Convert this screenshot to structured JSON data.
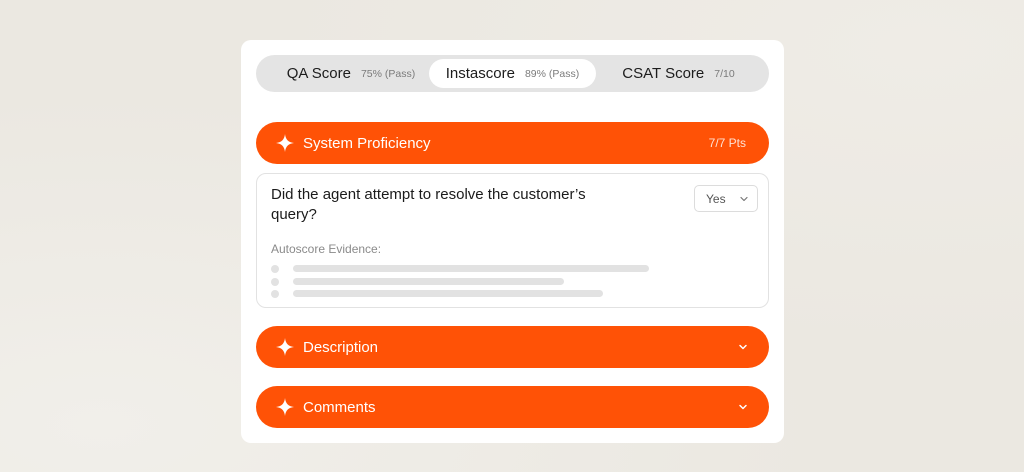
{
  "tabs": [
    {
      "label": "QA Score",
      "meta": "75% (Pass)",
      "active": false
    },
    {
      "label": "Instascore",
      "meta": "89% (Pass)",
      "active": true
    },
    {
      "label": "CSAT Score",
      "meta": "7/10",
      "active": false
    }
  ],
  "sections": {
    "system_proficiency": {
      "title": "System Proficiency",
      "points": "7/7 Pts",
      "icon": "sparkle-icon"
    },
    "description": {
      "title": "Description",
      "icon": "sparkle-icon"
    },
    "comments": {
      "title": "Comments",
      "icon": "sparkle-icon"
    }
  },
  "question": {
    "text": "Did the agent attempt to resolve the customer’s query?",
    "answer": "Yes",
    "evidence_label": "Autoscore Evidence:"
  },
  "colors": {
    "accent": "#ff5206",
    "card": "#ffffff",
    "background": "#ebe8e1",
    "tab_track": "#e4e4e4",
    "placeholder": "#e2e2e2"
  }
}
